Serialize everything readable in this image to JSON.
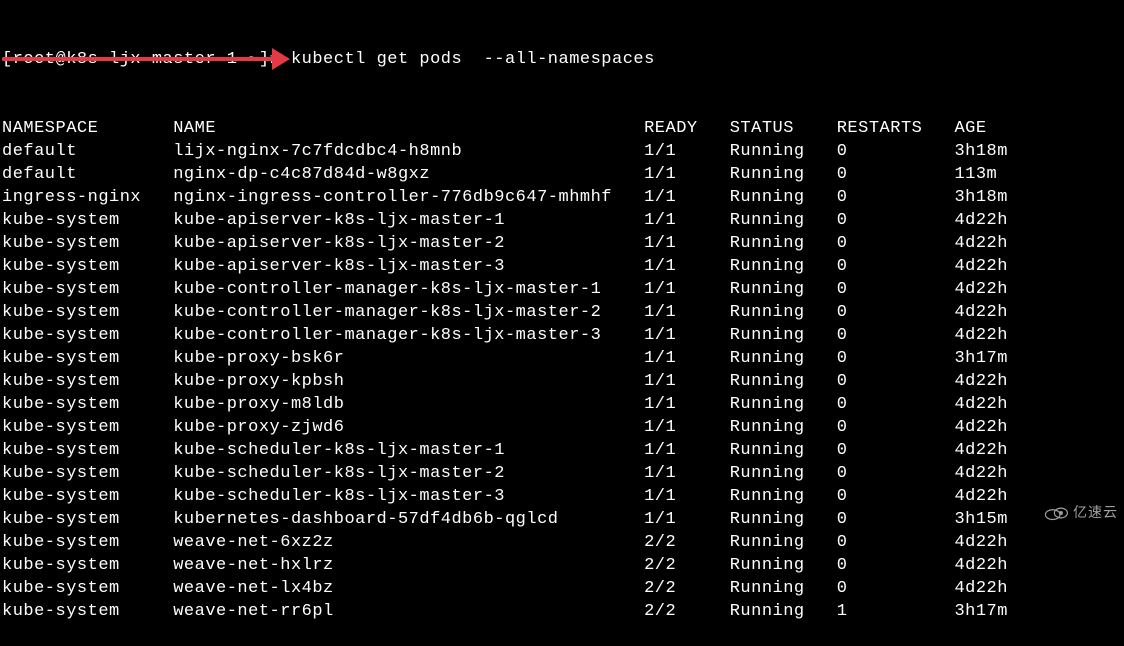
{
  "prompt": {
    "prefix": "[root@k8s-ljx-master-1 ~]#",
    "command": "kubectl get pods  --all-namespaces"
  },
  "headers": {
    "namespace": "NAMESPACE",
    "name": "NAME",
    "ready": "READY",
    "status": "STATUS",
    "restarts": "RESTARTS",
    "age": "AGE"
  },
  "rows": [
    {
      "namespace": "default",
      "name": "lijx-nginx-7c7fdcdbc4-h8mnb",
      "ready": "1/1",
      "status": "Running",
      "restarts": "0",
      "age": "3h18m"
    },
    {
      "namespace": "default",
      "name": "nginx-dp-c4c87d84d-w8gxz",
      "ready": "1/1",
      "status": "Running",
      "restarts": "0",
      "age": "113m"
    },
    {
      "namespace": "ingress-nginx",
      "name": "nginx-ingress-controller-776db9c647-mhmhf",
      "ready": "1/1",
      "status": "Running",
      "restarts": "0",
      "age": "3h18m"
    },
    {
      "namespace": "kube-system",
      "name": "kube-apiserver-k8s-ljx-master-1",
      "ready": "1/1",
      "status": "Running",
      "restarts": "0",
      "age": "4d22h"
    },
    {
      "namespace": "kube-system",
      "name": "kube-apiserver-k8s-ljx-master-2",
      "ready": "1/1",
      "status": "Running",
      "restarts": "0",
      "age": "4d22h"
    },
    {
      "namespace": "kube-system",
      "name": "kube-apiserver-k8s-ljx-master-3",
      "ready": "1/1",
      "status": "Running",
      "restarts": "0",
      "age": "4d22h"
    },
    {
      "namespace": "kube-system",
      "name": "kube-controller-manager-k8s-ljx-master-1",
      "ready": "1/1",
      "status": "Running",
      "restarts": "0",
      "age": "4d22h"
    },
    {
      "namespace": "kube-system",
      "name": "kube-controller-manager-k8s-ljx-master-2",
      "ready": "1/1",
      "status": "Running",
      "restarts": "0",
      "age": "4d22h"
    },
    {
      "namespace": "kube-system",
      "name": "kube-controller-manager-k8s-ljx-master-3",
      "ready": "1/1",
      "status": "Running",
      "restarts": "0",
      "age": "4d22h"
    },
    {
      "namespace": "kube-system",
      "name": "kube-proxy-bsk6r",
      "ready": "1/1",
      "status": "Running",
      "restarts": "0",
      "age": "3h17m"
    },
    {
      "namespace": "kube-system",
      "name": "kube-proxy-kpbsh",
      "ready": "1/1",
      "status": "Running",
      "restarts": "0",
      "age": "4d22h"
    },
    {
      "namespace": "kube-system",
      "name": "kube-proxy-m8ldb",
      "ready": "1/1",
      "status": "Running",
      "restarts": "0",
      "age": "4d22h"
    },
    {
      "namespace": "kube-system",
      "name": "kube-proxy-zjwd6",
      "ready": "1/1",
      "status": "Running",
      "restarts": "0",
      "age": "4d22h"
    },
    {
      "namespace": "kube-system",
      "name": "kube-scheduler-k8s-ljx-master-1",
      "ready": "1/1",
      "status": "Running",
      "restarts": "0",
      "age": "4d22h"
    },
    {
      "namespace": "kube-system",
      "name": "kube-scheduler-k8s-ljx-master-2",
      "ready": "1/1",
      "status": "Running",
      "restarts": "0",
      "age": "4d22h"
    },
    {
      "namespace": "kube-system",
      "name": "kube-scheduler-k8s-ljx-master-3",
      "ready": "1/1",
      "status": "Running",
      "restarts": "0",
      "age": "4d22h"
    },
    {
      "namespace": "kube-system",
      "name": "kubernetes-dashboard-57df4db6b-qglcd",
      "ready": "1/1",
      "status": "Running",
      "restarts": "0",
      "age": "3h15m"
    },
    {
      "namespace": "kube-system",
      "name": "weave-net-6xz2z",
      "ready": "2/2",
      "status": "Running",
      "restarts": "0",
      "age": "4d22h"
    },
    {
      "namespace": "kube-system",
      "name": "weave-net-hxlrz",
      "ready": "2/2",
      "status": "Running",
      "restarts": "0",
      "age": "4d22h"
    },
    {
      "namespace": "kube-system",
      "name": "weave-net-lx4bz",
      "ready": "2/2",
      "status": "Running",
      "restarts": "0",
      "age": "4d22h"
    },
    {
      "namespace": "kube-system",
      "name": "weave-net-rr6pl",
      "ready": "2/2",
      "status": "Running",
      "restarts": "1",
      "age": "3h17m"
    }
  ],
  "watermark": {
    "text": "亿速云"
  },
  "columns": {
    "namespace_w": 16,
    "name_w": 44,
    "ready_w": 8,
    "status_w": 10,
    "restarts_w": 11
  }
}
